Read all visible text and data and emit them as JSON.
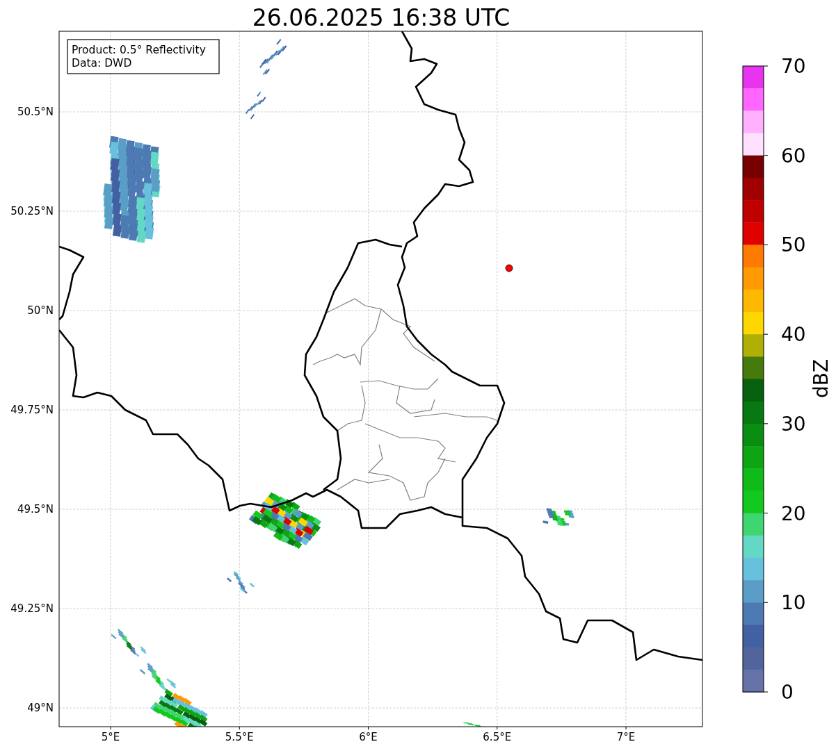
{
  "title": "26.06.2025 16:38 UTC",
  "info_box": [
    "Product: 0.5° Reflectivity",
    "Data: DWD"
  ],
  "map": {
    "x_ticks": [
      "5°E",
      "5.5°E",
      "6°E",
      "6.5°E",
      "7°E"
    ],
    "y_ticks": [
      "50.5°N",
      "50.25°N",
      "50°N",
      "49.75°N",
      "49.5°N",
      "49.25°N",
      "49°N"
    ]
  },
  "colorbar": {
    "label": "dBZ",
    "ticks": [
      "70",
      "60",
      "50",
      "40",
      "30",
      "20",
      "10",
      "0"
    ],
    "bands": [
      {
        "color": "#e833ef"
      },
      {
        "color": "#ff66ff"
      },
      {
        "color": "#ffb0ff"
      },
      {
        "color": "#ffe0ff"
      },
      {
        "color": "#780000"
      },
      {
        "color": "#a00000"
      },
      {
        "color": "#c00000"
      },
      {
        "color": "#e00000"
      },
      {
        "color": "#ff7a00"
      },
      {
        "color": "#ff9a00"
      },
      {
        "color": "#ffb800"
      },
      {
        "color": "#ffd700"
      },
      {
        "color": "#b0b004"
      },
      {
        "color": "#467a0a"
      },
      {
        "color": "#06600e"
      },
      {
        "color": "#087811"
      },
      {
        "color": "#0a8e12"
      },
      {
        "color": "#0ea514"
      },
      {
        "color": "#10ba18"
      },
      {
        "color": "#12c91d"
      },
      {
        "color": "#3fd672"
      },
      {
        "color": "#62d8c5"
      },
      {
        "color": "#67c1dd"
      },
      {
        "color": "#5a9ec8"
      },
      {
        "color": "#4d7ab2"
      },
      {
        "color": "#4360a2"
      },
      {
        "color": "#51659c"
      },
      {
        "color": "#6673a8"
      }
    ]
  }
}
